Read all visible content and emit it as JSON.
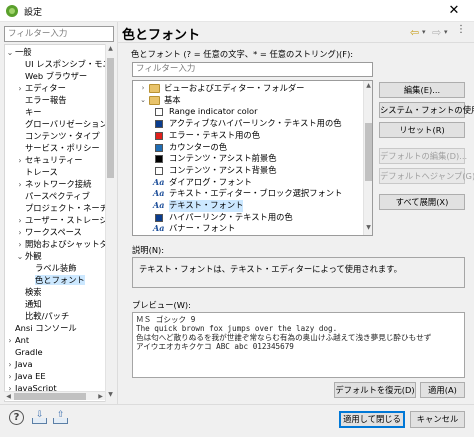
{
  "window": {
    "title": "設定",
    "close_glyph": "✕"
  },
  "left": {
    "filter_placeholder": "フィルター入力",
    "tree": [
      {
        "label": "一般",
        "arrow": "⌄",
        "level": 0
      },
      {
        "label": "UI レスポンシブ・モニター",
        "arrow": "",
        "level": 1
      },
      {
        "label": "Web ブラウザー",
        "arrow": "",
        "level": 1
      },
      {
        "label": "エディター",
        "arrow": "›",
        "level": 1
      },
      {
        "label": "エラー報告",
        "arrow": "",
        "level": 1
      },
      {
        "label": "キー",
        "arrow": "",
        "level": 1
      },
      {
        "label": "グローバリゼーション",
        "arrow": "",
        "level": 1
      },
      {
        "label": "コンテンツ・タイプ",
        "arrow": "",
        "level": 1
      },
      {
        "label": "サービス・ポリシー",
        "arrow": "",
        "level": 1
      },
      {
        "label": "セキュリティー",
        "arrow": "›",
        "level": 1
      },
      {
        "label": "トレース",
        "arrow": "",
        "level": 1
      },
      {
        "label": "ネットワーク接続",
        "arrow": "›",
        "level": 1
      },
      {
        "label": "パースペクティブ",
        "arrow": "",
        "level": 1
      },
      {
        "label": "プロジェクト・ネーチャー",
        "arrow": "",
        "level": 1
      },
      {
        "label": "ユーザー・ストレージ・サービ",
        "arrow": "›",
        "level": 1
      },
      {
        "label": "ワークスペース",
        "arrow": "›",
        "level": 1
      },
      {
        "label": "開始およびシャットダウン",
        "arrow": "›",
        "level": 1
      },
      {
        "label": "外観",
        "arrow": "⌄",
        "level": 1
      },
      {
        "label": "ラベル装飾",
        "arrow": "",
        "level": 2
      },
      {
        "label": "色とフォント",
        "arrow": "",
        "level": 2,
        "selected": true
      },
      {
        "label": "検索",
        "arrow": "",
        "level": 1
      },
      {
        "label": "通知",
        "arrow": "",
        "level": 1
      },
      {
        "label": "比較/パッチ",
        "arrow": "",
        "level": 1
      },
      {
        "label": "Ansi コンソール",
        "arrow": "",
        "level": 0
      },
      {
        "label": "Ant",
        "arrow": "›",
        "level": 0
      },
      {
        "label": "Gradle",
        "arrow": "",
        "level": 0
      },
      {
        "label": "Java",
        "arrow": "›",
        "level": 0
      },
      {
        "label": "Java EE",
        "arrow": "›",
        "level": 0
      },
      {
        "label": "JavaScript",
        "arrow": "›",
        "level": 0
      }
    ]
  },
  "page": {
    "title": "色とフォント",
    "nav": {
      "back": "⇦",
      "forward": "⇨",
      "dropdown": "▾",
      "menu": "⋮"
    },
    "colors_label": "色とフォント (? = 任意の文字、* = 任意のストリング)(F):",
    "filter_placeholder": "フィルター入力",
    "tree": [
      {
        "label": "ビューおよびエディター・フォルダー",
        "kind": "folder",
        "arrow": "›",
        "indent": 0
      },
      {
        "label": "基本",
        "kind": "folder",
        "arrow": "⌄",
        "indent": 0
      },
      {
        "label": "Range indicator color",
        "kind": "color",
        "color": "#ffffff",
        "indent": 1
      },
      {
        "label": "アクティブなハイパーリンク・テキスト用の色",
        "kind": "color",
        "color": "#0a3d8f",
        "indent": 1
      },
      {
        "label": "エラー・テキスト用の色",
        "kind": "color",
        "color": "#e0201c",
        "indent": 1
      },
      {
        "label": "カウンターの色",
        "kind": "color",
        "color": "#1f6db4",
        "indent": 1
      },
      {
        "label": "コンテンツ・アシスト前景色",
        "kind": "color",
        "color": "#000000",
        "indent": 1
      },
      {
        "label": "コンテンツ・アシスト背景色",
        "kind": "color",
        "color": "#ffffff",
        "indent": 1
      },
      {
        "label": "ダイアログ・フォント",
        "kind": "font",
        "indent": 1
      },
      {
        "label": "テキスト・エディター・ブロック選択フォント",
        "kind": "font",
        "indent": 1
      },
      {
        "label": "テキスト・フォント",
        "kind": "font",
        "indent": 1,
        "selected": true
      },
      {
        "label": "ハイパーリンク・テキスト用の色",
        "kind": "color",
        "color": "#0a3d8f",
        "indent": 1
      },
      {
        "label": "バナー・フォント",
        "kind": "font",
        "indent": 1
      }
    ],
    "font_glyph": "Aa",
    "buttons": {
      "edit": "編集(E)...",
      "use_system_font": "システム・フォントの使用(U)",
      "reset": "リセット(R)",
      "edit_default": "デフォルトの編集(D)...",
      "go_to_default": "デフォルトへジャンプ(G)",
      "expand_all": "すべて展開(X)"
    },
    "description_label": "説明(N):",
    "description_text": "テキスト・フォントは、テキスト・エディターによって使用されます。",
    "preview_label": "プレビュー(W):",
    "preview_lines": [
      "ＭＳ ゴシック 9",
      "The quick brown fox jumps over the lazy dog.",
      "色は匂へど散りぬるを我が世誰ぞ常ならむ有為の奥山けふ越えて浅き夢見じ酔ひもせず",
      "アイウエオカキクケコ ABC abc 012345679"
    ],
    "restore_defaults": "デフォルトを復元(D)",
    "apply": "適用(A)"
  },
  "footer": {
    "help": "?",
    "apply_close": "適用して閉じる",
    "cancel": "キャンセル",
    "import_arrow": "⇩",
    "export_arrow": "⇧"
  }
}
